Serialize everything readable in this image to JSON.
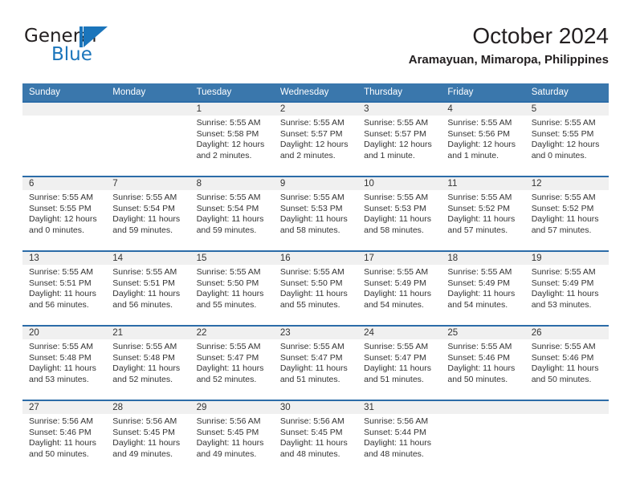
{
  "brand": {
    "word1": "General",
    "word2": "Blue",
    "logo_icon": "general-blue-triangle-logo",
    "accent_color": "#1b75bb"
  },
  "header": {
    "month_title": "October 2024",
    "location": "Aramayuan, Mimaropa, Philippines",
    "header_bg_color": "#3a77ac",
    "row_divider_color": "#2c6ca8",
    "datestrip_bg_color": "#f0f0f0"
  },
  "calendar": {
    "weekday_headers": [
      "Sunday",
      "Monday",
      "Tuesday",
      "Wednesday",
      "Thursday",
      "Friday",
      "Saturday"
    ],
    "weeks": [
      [
        {
          "day": "",
          "lines": []
        },
        {
          "day": "",
          "lines": []
        },
        {
          "day": "1",
          "lines": [
            "Sunrise: 5:55 AM",
            "Sunset: 5:58 PM",
            "Daylight: 12 hours",
            "and 2 minutes."
          ]
        },
        {
          "day": "2",
          "lines": [
            "Sunrise: 5:55 AM",
            "Sunset: 5:57 PM",
            "Daylight: 12 hours",
            "and 2 minutes."
          ]
        },
        {
          "day": "3",
          "lines": [
            "Sunrise: 5:55 AM",
            "Sunset: 5:57 PM",
            "Daylight: 12 hours",
            "and 1 minute."
          ]
        },
        {
          "day": "4",
          "lines": [
            "Sunrise: 5:55 AM",
            "Sunset: 5:56 PM",
            "Daylight: 12 hours",
            "and 1 minute."
          ]
        },
        {
          "day": "5",
          "lines": [
            "Sunrise: 5:55 AM",
            "Sunset: 5:55 PM",
            "Daylight: 12 hours",
            "and 0 minutes."
          ]
        }
      ],
      [
        {
          "day": "6",
          "lines": [
            "Sunrise: 5:55 AM",
            "Sunset: 5:55 PM",
            "Daylight: 12 hours",
            "and 0 minutes."
          ]
        },
        {
          "day": "7",
          "lines": [
            "Sunrise: 5:55 AM",
            "Sunset: 5:54 PM",
            "Daylight: 11 hours",
            "and 59 minutes."
          ]
        },
        {
          "day": "8",
          "lines": [
            "Sunrise: 5:55 AM",
            "Sunset: 5:54 PM",
            "Daylight: 11 hours",
            "and 59 minutes."
          ]
        },
        {
          "day": "9",
          "lines": [
            "Sunrise: 5:55 AM",
            "Sunset: 5:53 PM",
            "Daylight: 11 hours",
            "and 58 minutes."
          ]
        },
        {
          "day": "10",
          "lines": [
            "Sunrise: 5:55 AM",
            "Sunset: 5:53 PM",
            "Daylight: 11 hours",
            "and 58 minutes."
          ]
        },
        {
          "day": "11",
          "lines": [
            "Sunrise: 5:55 AM",
            "Sunset: 5:52 PM",
            "Daylight: 11 hours",
            "and 57 minutes."
          ]
        },
        {
          "day": "12",
          "lines": [
            "Sunrise: 5:55 AM",
            "Sunset: 5:52 PM",
            "Daylight: 11 hours",
            "and 57 minutes."
          ]
        }
      ],
      [
        {
          "day": "13",
          "lines": [
            "Sunrise: 5:55 AM",
            "Sunset: 5:51 PM",
            "Daylight: 11 hours",
            "and 56 minutes."
          ]
        },
        {
          "day": "14",
          "lines": [
            "Sunrise: 5:55 AM",
            "Sunset: 5:51 PM",
            "Daylight: 11 hours",
            "and 56 minutes."
          ]
        },
        {
          "day": "15",
          "lines": [
            "Sunrise: 5:55 AM",
            "Sunset: 5:50 PM",
            "Daylight: 11 hours",
            "and 55 minutes."
          ]
        },
        {
          "day": "16",
          "lines": [
            "Sunrise: 5:55 AM",
            "Sunset: 5:50 PM",
            "Daylight: 11 hours",
            "and 55 minutes."
          ]
        },
        {
          "day": "17",
          "lines": [
            "Sunrise: 5:55 AM",
            "Sunset: 5:49 PM",
            "Daylight: 11 hours",
            "and 54 minutes."
          ]
        },
        {
          "day": "18",
          "lines": [
            "Sunrise: 5:55 AM",
            "Sunset: 5:49 PM",
            "Daylight: 11 hours",
            "and 54 minutes."
          ]
        },
        {
          "day": "19",
          "lines": [
            "Sunrise: 5:55 AM",
            "Sunset: 5:49 PM",
            "Daylight: 11 hours",
            "and 53 minutes."
          ]
        }
      ],
      [
        {
          "day": "20",
          "lines": [
            "Sunrise: 5:55 AM",
            "Sunset: 5:48 PM",
            "Daylight: 11 hours",
            "and 53 minutes."
          ]
        },
        {
          "day": "21",
          "lines": [
            "Sunrise: 5:55 AM",
            "Sunset: 5:48 PM",
            "Daylight: 11 hours",
            "and 52 minutes."
          ]
        },
        {
          "day": "22",
          "lines": [
            "Sunrise: 5:55 AM",
            "Sunset: 5:47 PM",
            "Daylight: 11 hours",
            "and 52 minutes."
          ]
        },
        {
          "day": "23",
          "lines": [
            "Sunrise: 5:55 AM",
            "Sunset: 5:47 PM",
            "Daylight: 11 hours",
            "and 51 minutes."
          ]
        },
        {
          "day": "24",
          "lines": [
            "Sunrise: 5:55 AM",
            "Sunset: 5:47 PM",
            "Daylight: 11 hours",
            "and 51 minutes."
          ]
        },
        {
          "day": "25",
          "lines": [
            "Sunrise: 5:55 AM",
            "Sunset: 5:46 PM",
            "Daylight: 11 hours",
            "and 50 minutes."
          ]
        },
        {
          "day": "26",
          "lines": [
            "Sunrise: 5:55 AM",
            "Sunset: 5:46 PM",
            "Daylight: 11 hours",
            "and 50 minutes."
          ]
        }
      ],
      [
        {
          "day": "27",
          "lines": [
            "Sunrise: 5:56 AM",
            "Sunset: 5:46 PM",
            "Daylight: 11 hours",
            "and 50 minutes."
          ]
        },
        {
          "day": "28",
          "lines": [
            "Sunrise: 5:56 AM",
            "Sunset: 5:45 PM",
            "Daylight: 11 hours",
            "and 49 minutes."
          ]
        },
        {
          "day": "29",
          "lines": [
            "Sunrise: 5:56 AM",
            "Sunset: 5:45 PM",
            "Daylight: 11 hours",
            "and 49 minutes."
          ]
        },
        {
          "day": "30",
          "lines": [
            "Sunrise: 5:56 AM",
            "Sunset: 5:45 PM",
            "Daylight: 11 hours",
            "and 48 minutes."
          ]
        },
        {
          "day": "31",
          "lines": [
            "Sunrise: 5:56 AM",
            "Sunset: 5:44 PM",
            "Daylight: 11 hours",
            "and 48 minutes."
          ]
        },
        {
          "day": "",
          "lines": []
        },
        {
          "day": "",
          "lines": []
        }
      ]
    ]
  }
}
